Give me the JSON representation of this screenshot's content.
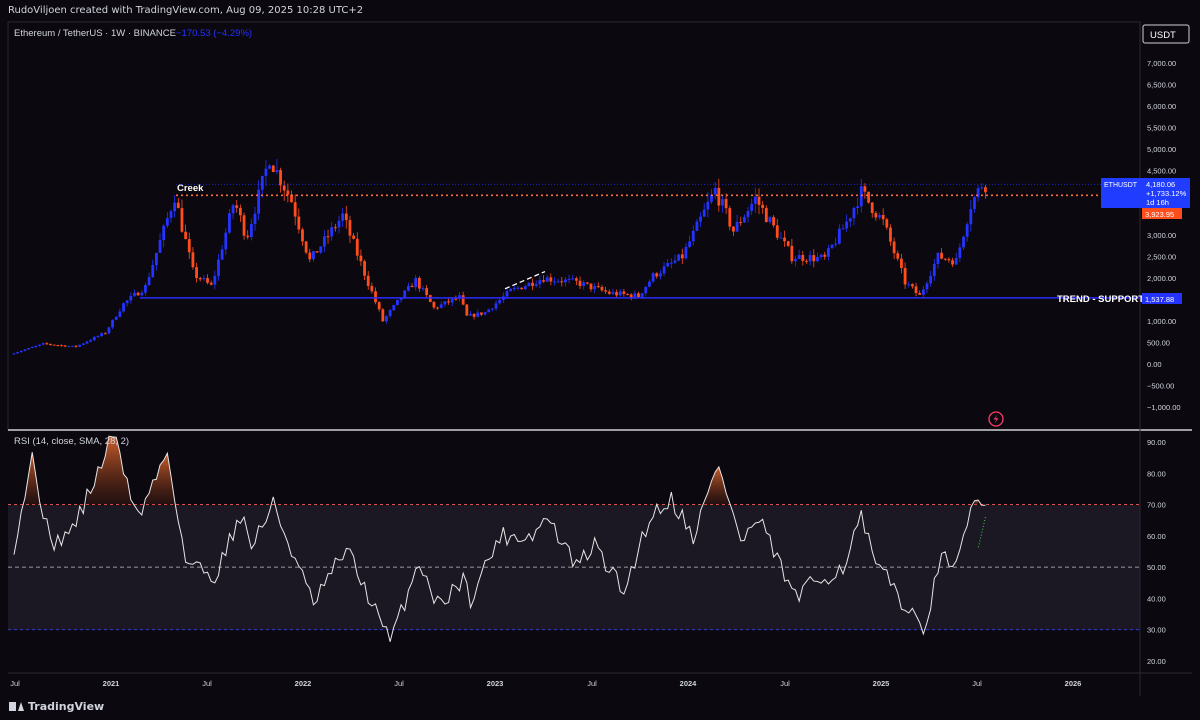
{
  "header": {
    "credit": "RudoViljoen created with TradingView.com, Aug 09, 2025 10:28 UTC+2",
    "symbol": "Ethereum / TetherUS · 1W · BINANCE",
    "change": "−170.53 (−4.29%)",
    "currency": "USDT"
  },
  "footer": {
    "brand": "TradingView"
  },
  "colors": {
    "up": "#2433ff",
    "down": "#ff4d1c",
    "support": "#2b2bff",
    "creek": "#ff6a3d",
    "rsi": "#e6e6e6",
    "panel": "#1b1823"
  },
  "chart_data": [
    {
      "type": "candlestick",
      "title": "Ethereum / TetherUS · 1W · BINANCE",
      "x_ticks": [
        "Jul",
        "2021",
        "Jul",
        "2022",
        "Jul",
        "2023",
        "Jul",
        "2024",
        "Jul",
        "2025",
        "Jul",
        "2026"
      ],
      "y_ticks": [
        "7,000.00",
        "6,500.00",
        "6,000.00",
        "5,500.00",
        "5,000.00",
        "4,500.00",
        "4,000.00",
        "3,500.00",
        "3,000.00",
        "2,500.00",
        "2,000.00",
        "1,500.00",
        "1,000.00",
        "500.00",
        "0.00",
        "−500.00",
        "−1,000.00"
      ],
      "ylim": [
        -1200,
        7300
      ],
      "price_path": [
        [
          "2020-06-29",
          230
        ],
        [
          "2020-09-01",
          470
        ],
        [
          "2020-11-01",
          400
        ],
        [
          "2020-12-28",
          730
        ],
        [
          "2021-02-01",
          1400
        ],
        [
          "2021-03-15",
          1800
        ],
        [
          "2021-05-10",
          3900
        ],
        [
          "2021-06-15",
          2100
        ],
        [
          "2021-07-20",
          1800
        ],
        [
          "2021-09-01",
          3800
        ],
        [
          "2021-09-25",
          2950
        ],
        [
          "2021-11-08",
          4800
        ],
        [
          "2021-12-20",
          3800
        ],
        [
          "2022-01-24",
          2400
        ],
        [
          "2022-03-28",
          3450
        ],
        [
          "2022-06-13",
          1000
        ],
        [
          "2022-07-18",
          1550
        ],
        [
          "2022-08-15",
          1950
        ],
        [
          "2022-09-19",
          1300
        ],
        [
          "2022-11-07",
          1550
        ],
        [
          "2022-11-21",
          1100
        ],
        [
          "2022-12-26",
          1200
        ],
        [
          "2023-02-13",
          1700
        ],
        [
          "2023-04-17",
          2000
        ],
        [
          "2023-06-19",
          1900
        ],
        [
          "2023-08-21",
          1650
        ],
        [
          "2023-10-16",
          1580
        ],
        [
          "2023-11-13",
          2050
        ],
        [
          "2024-01-08",
          2500
        ],
        [
          "2024-03-11",
          4050
        ],
        [
          "2024-04-15",
          3100
        ],
        [
          "2024-05-27",
          3850
        ],
        [
          "2024-08-05",
          2500
        ],
        [
          "2024-10-07",
          2450
        ],
        [
          "2024-11-18",
          3300
        ],
        [
          "2024-12-16",
          4000
        ],
        [
          "2025-01-27",
          3300
        ],
        [
          "2025-03-10",
          1900
        ],
        [
          "2025-04-07",
          1580
        ],
        [
          "2025-05-12",
          2500
        ],
        [
          "2025-06-16",
          2400
        ],
        [
          "2025-07-14",
          3700
        ],
        [
          "2025-08-04",
          4180
        ]
      ],
      "levels": [
        {
          "name": "Creek",
          "value": 3924,
          "style": "dotted"
        },
        {
          "name": "TREND - SUPPORT",
          "value": 1537.88,
          "style": "solid"
        }
      ],
      "price_labels": [
        {
          "symbol": "ETHUSDT",
          "price": "4,180.06",
          "change": "+1,733.12%",
          "countdown": "1d 16h"
        },
        {
          "price": "3,923.95"
        },
        {
          "price": "1,537.88"
        }
      ]
    },
    {
      "type": "line",
      "title": "RSI (14, close, SMA, 28, 2)",
      "y_ticks": [
        "90.00",
        "80.00",
        "70.00",
        "60.00",
        "50.00",
        "40.00",
        "30.00",
        "20.00"
      ],
      "ylim": [
        16.5,
        94
      ],
      "bands": {
        "upper": 70,
        "middle": 50,
        "lower": 30
      },
      "rsi_path": [
        [
          "2020-06-29",
          57
        ],
        [
          "2020-08-03",
          85
        ],
        [
          "2020-09-07",
          57
        ],
        [
          "2020-10-19",
          62
        ],
        [
          "2020-12-07",
          80
        ],
        [
          "2021-01-04",
          93
        ],
        [
          "2021-02-22",
          66
        ],
        [
          "2021-04-19",
          87
        ],
        [
          "2021-05-24",
          52
        ],
        [
          "2021-07-19",
          47
        ],
        [
          "2021-09-06",
          67
        ],
        [
          "2021-09-27",
          57
        ],
        [
          "2021-11-08",
          70
        ],
        [
          "2022-01-24",
          38
        ],
        [
          "2022-03-28",
          56
        ],
        [
          "2022-06-20",
          26
        ],
        [
          "2022-08-15",
          52
        ],
        [
          "2022-09-19",
          38
        ],
        [
          "2022-11-07",
          46
        ],
        [
          "2022-11-21",
          40
        ],
        [
          "2023-01-16",
          60
        ],
        [
          "2023-03-20",
          60
        ],
        [
          "2023-04-17",
          66
        ],
        [
          "2023-06-12",
          50
        ],
        [
          "2023-07-17",
          57
        ],
        [
          "2023-09-11",
          42
        ],
        [
          "2023-10-30",
          66
        ],
        [
          "2023-12-11",
          72
        ],
        [
          "2024-01-22",
          60
        ],
        [
          "2024-03-11",
          83
        ],
        [
          "2024-04-22",
          58
        ],
        [
          "2024-05-27",
          65
        ],
        [
          "2024-08-05",
          40
        ],
        [
          "2024-09-09",
          45
        ],
        [
          "2024-11-04",
          50
        ],
        [
          "2024-12-09",
          66
        ],
        [
          "2025-01-06",
          50
        ],
        [
          "2025-02-10",
          44
        ],
        [
          "2025-03-10",
          35
        ],
        [
          "2025-04-07",
          31
        ],
        [
          "2025-05-12",
          52
        ],
        [
          "2025-06-16",
          53
        ],
        [
          "2025-07-14",
          71
        ],
        [
          "2025-08-04",
          69
        ]
      ]
    }
  ]
}
